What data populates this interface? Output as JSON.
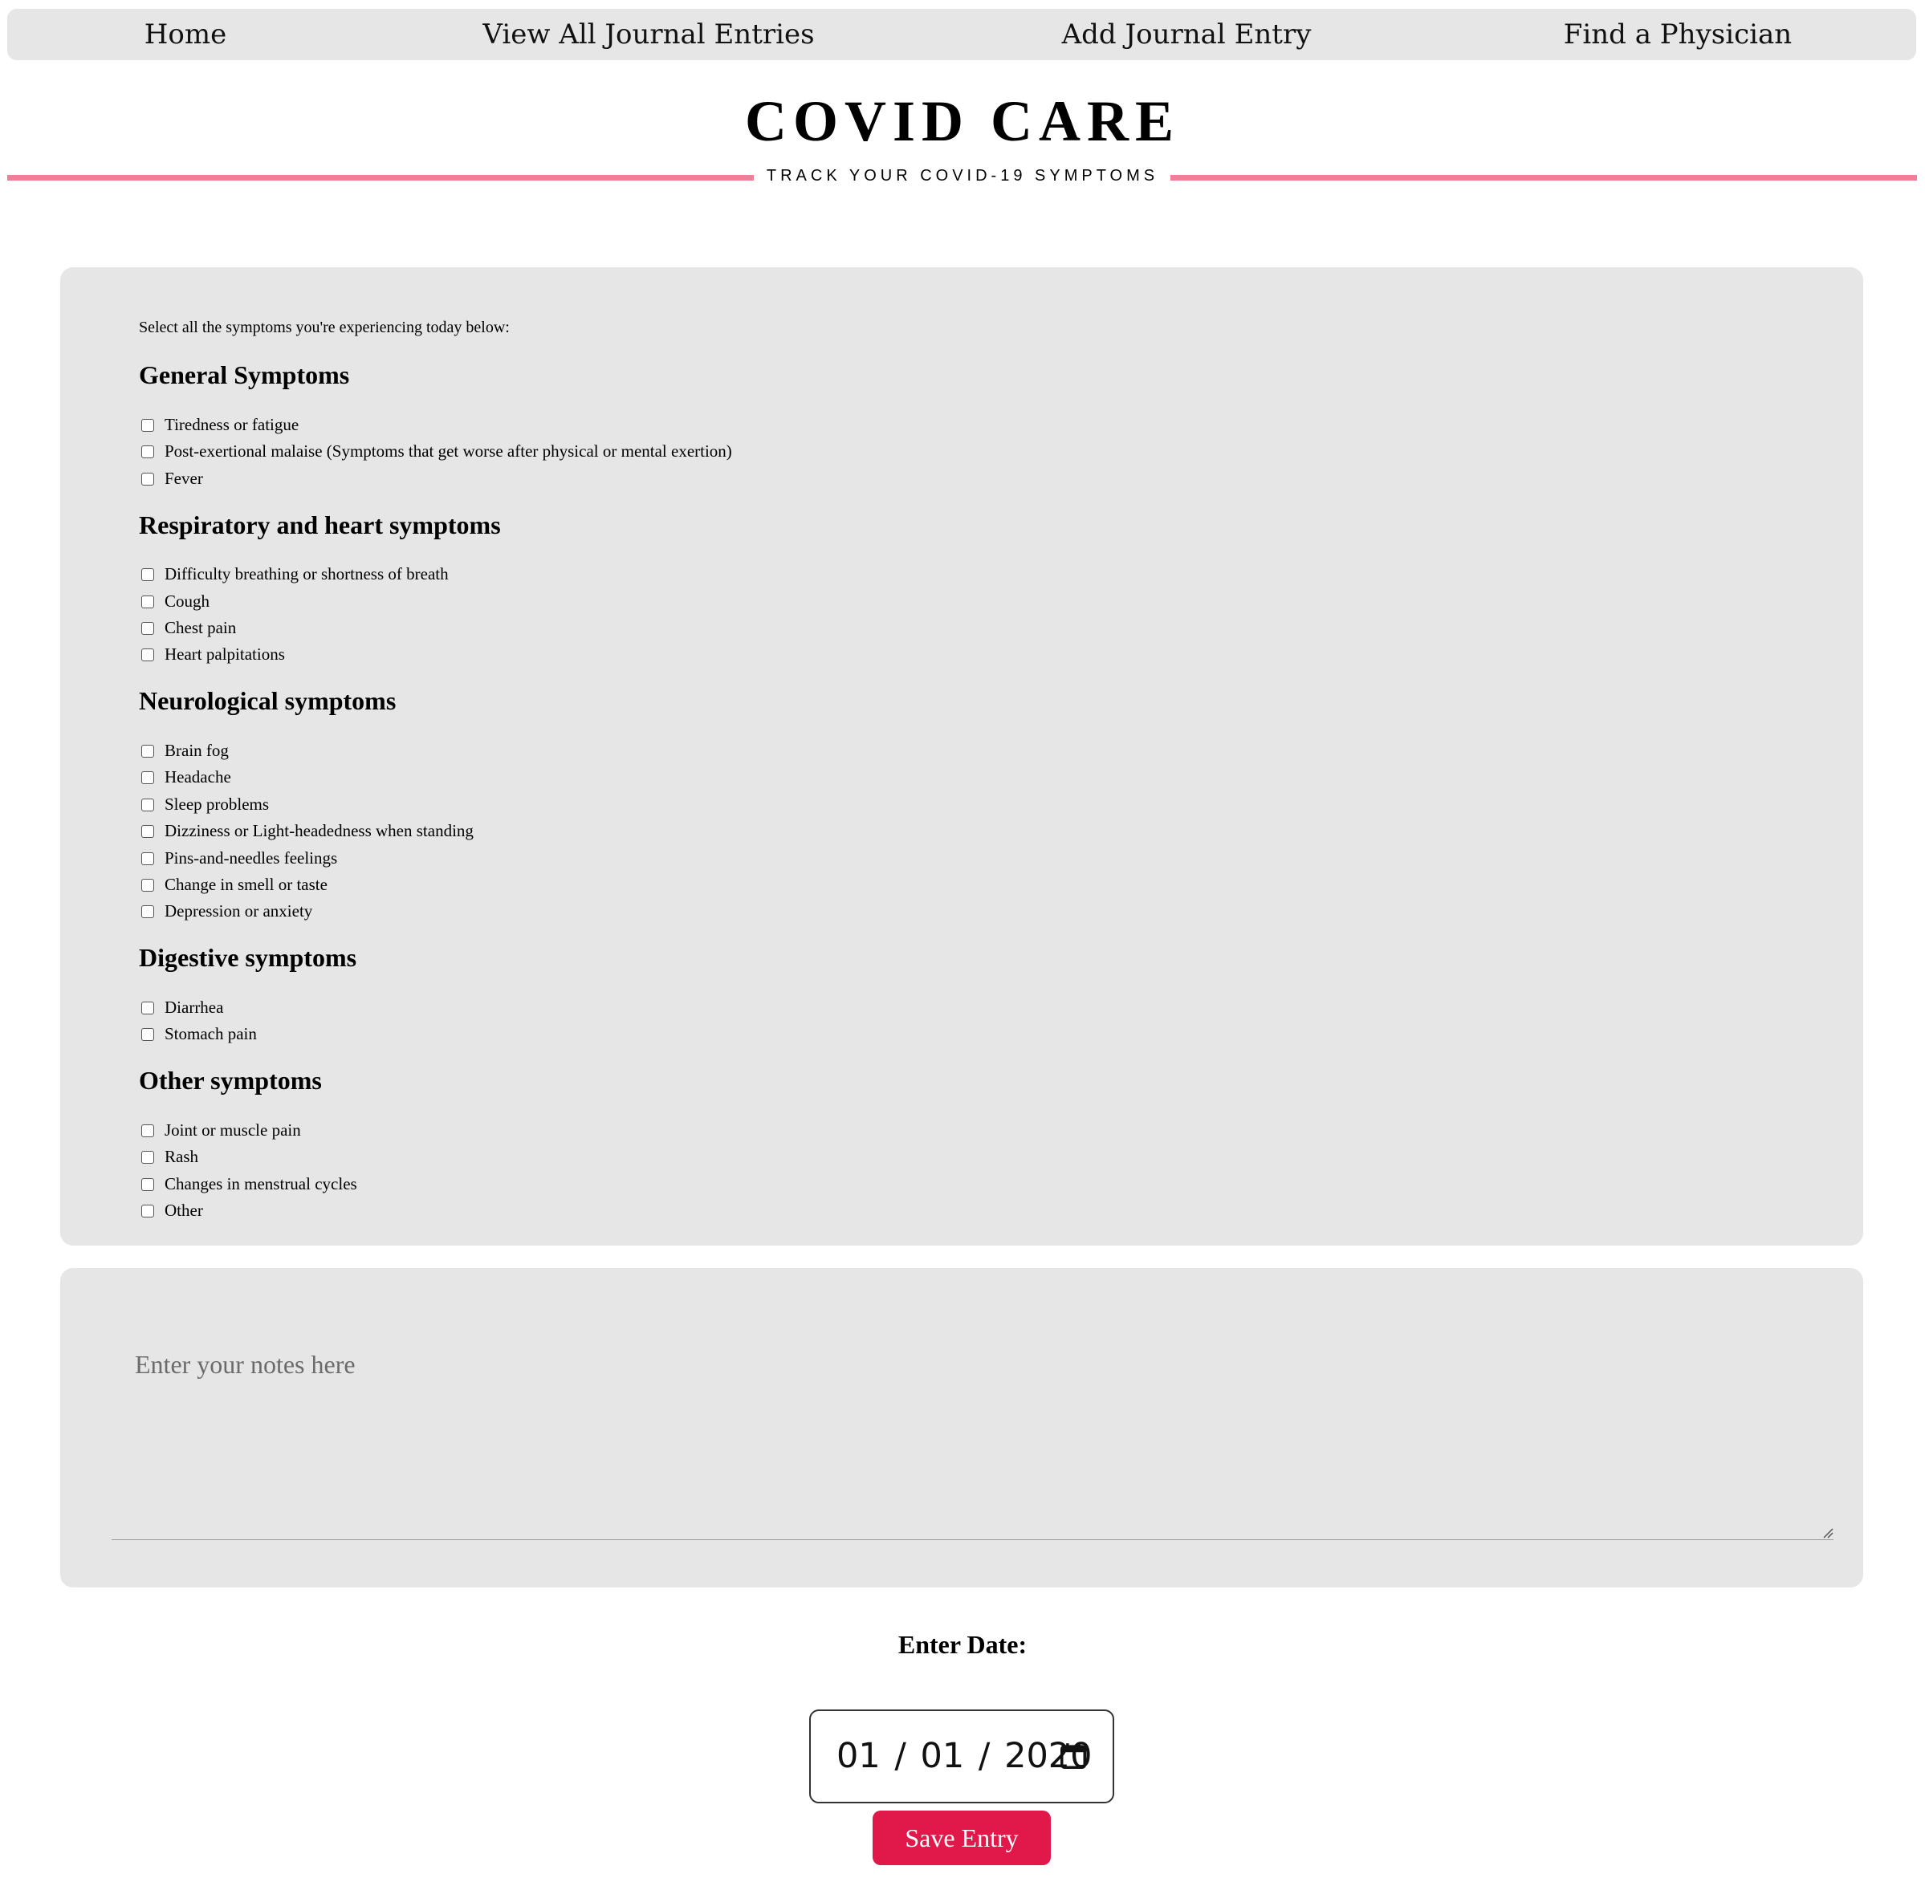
{
  "nav": {
    "items": [
      {
        "label": "Home"
      },
      {
        "label": "View All Journal Entries"
      },
      {
        "label": "Add Journal Entry"
      },
      {
        "label": "Find a Physician"
      }
    ]
  },
  "header": {
    "title": "COVID CARE",
    "subtitle": "TRACK YOUR COVID-19 SYMPTOMS",
    "accent_color": "#ef7f99"
  },
  "symptoms": {
    "intro": "Select all the symptoms you're experiencing today below:",
    "groups": [
      {
        "title": "General Symptoms",
        "items": [
          {
            "label": "Tiredness or fatigue",
            "checked": false
          },
          {
            "label": "Post-exertional malaise (Symptoms that get worse after physical or mental exertion)",
            "checked": false
          },
          {
            "label": "Fever",
            "checked": false
          }
        ]
      },
      {
        "title": "Respiratory and heart symptoms",
        "items": [
          {
            "label": "Difficulty breathing or shortness of breath",
            "checked": false
          },
          {
            "label": "Cough",
            "checked": false
          },
          {
            "label": "Chest pain",
            "checked": false
          },
          {
            "label": "Heart palpitations",
            "checked": false
          }
        ]
      },
      {
        "title": "Neurological symptoms",
        "items": [
          {
            "label": "Brain fog",
            "checked": false
          },
          {
            "label": "Headache",
            "checked": false
          },
          {
            "label": "Sleep problems",
            "checked": false
          },
          {
            "label": "Dizziness or Light-headedness when standing",
            "checked": false
          },
          {
            "label": "Pins-and-needles feelings",
            "checked": false
          },
          {
            "label": "Change in smell or taste",
            "checked": false
          },
          {
            "label": "Depression or anxiety",
            "checked": false
          }
        ]
      },
      {
        "title": "Digestive symptoms",
        "items": [
          {
            "label": "Diarrhea",
            "checked": false
          },
          {
            "label": "Stomach pain",
            "checked": false
          }
        ]
      },
      {
        "title": "Other symptoms",
        "items": [
          {
            "label": "Joint or muscle pain",
            "checked": false
          },
          {
            "label": "Rash",
            "checked": false
          },
          {
            "label": "Changes in menstrual cycles",
            "checked": false
          },
          {
            "label": "Other",
            "checked": false
          }
        ]
      }
    ]
  },
  "notes": {
    "placeholder": "Enter your notes here",
    "value": ""
  },
  "date": {
    "label": "Enter Date:",
    "value": "01 / 01 / 2020",
    "icon": "calendar-icon"
  },
  "save_button": {
    "label": "Save Entry",
    "color": "#e0194a"
  }
}
